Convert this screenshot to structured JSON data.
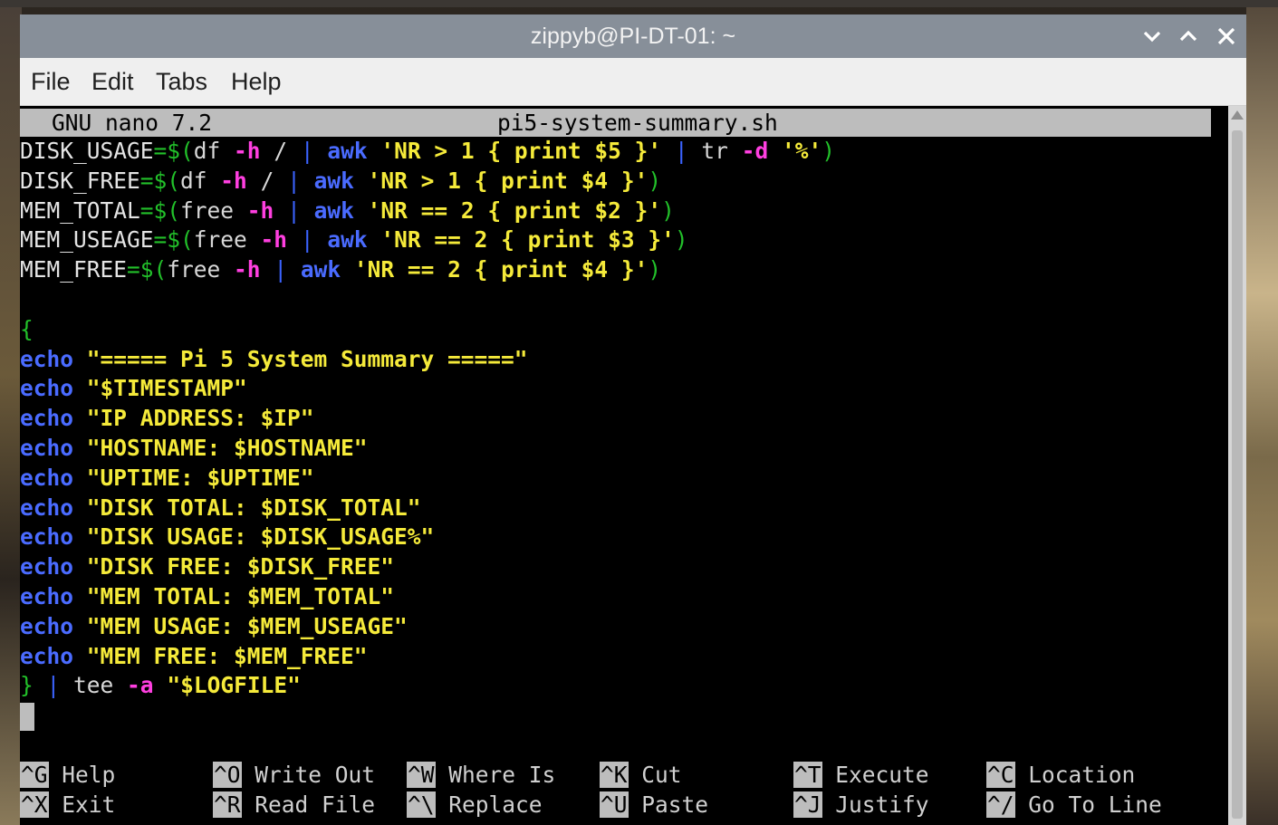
{
  "window": {
    "title": "zippyb@PI-DT-01: ~",
    "minimize_glyph": "⌵",
    "maximize_glyph": "⌃",
    "close_glyph": "✕"
  },
  "menu": {
    "file": "File",
    "edit": "Edit",
    "tabs": "Tabs",
    "help": "Help"
  },
  "nano": {
    "version": "GNU nano 7.2",
    "filename": "pi5-system-summary.sh"
  },
  "code_lines": [
    {
      "name": "disk-usage-line",
      "segments": [
        {
          "t": "DISK_USAGE",
          "c": "var"
        },
        {
          "t": "=$(",
          "c": "op"
        },
        {
          "t": "df ",
          "c": "cmd"
        },
        {
          "t": "-h",
          "c": "flag"
        },
        {
          "t": " / ",
          "c": "cmd"
        },
        {
          "t": "|",
          "c": "pipe"
        },
        {
          "t": " ",
          "c": "cmd"
        },
        {
          "t": "awk",
          "c": "kw"
        },
        {
          "t": " ",
          "c": "cmd"
        },
        {
          "t": "'NR > 1 { print $5 }'",
          "c": "str"
        },
        {
          "t": " | ",
          "c": "pipe"
        },
        {
          "t": "tr ",
          "c": "cmd"
        },
        {
          "t": "-d",
          "c": "flag"
        },
        {
          "t": " ",
          "c": "cmd"
        },
        {
          "t": "'%'",
          "c": "str"
        },
        {
          "t": ")",
          "c": "op"
        }
      ]
    },
    {
      "name": "disk-free-line",
      "segments": [
        {
          "t": "DISK_FREE",
          "c": "var"
        },
        {
          "t": "=$(",
          "c": "op"
        },
        {
          "t": "df ",
          "c": "cmd"
        },
        {
          "t": "-h",
          "c": "flag"
        },
        {
          "t": " / ",
          "c": "cmd"
        },
        {
          "t": "|",
          "c": "pipe"
        },
        {
          "t": " ",
          "c": "cmd"
        },
        {
          "t": "awk",
          "c": "kw"
        },
        {
          "t": " ",
          "c": "cmd"
        },
        {
          "t": "'NR > 1 { print $4 }'",
          "c": "str"
        },
        {
          "t": ")",
          "c": "op"
        }
      ]
    },
    {
      "name": "mem-total-line",
      "segments": [
        {
          "t": "MEM_TOTAL",
          "c": "var"
        },
        {
          "t": "=$(",
          "c": "op"
        },
        {
          "t": "free ",
          "c": "cmd"
        },
        {
          "t": "-h",
          "c": "flag"
        },
        {
          "t": " ",
          "c": "cmd"
        },
        {
          "t": "|",
          "c": "pipe"
        },
        {
          "t": " ",
          "c": "cmd"
        },
        {
          "t": "awk",
          "c": "kw"
        },
        {
          "t": " ",
          "c": "cmd"
        },
        {
          "t": "'NR == 2 { print $2 }'",
          "c": "str"
        },
        {
          "t": ")",
          "c": "op"
        }
      ]
    },
    {
      "name": "mem-useage-line",
      "segments": [
        {
          "t": "MEM_USEAGE",
          "c": "var"
        },
        {
          "t": "=$(",
          "c": "op"
        },
        {
          "t": "free ",
          "c": "cmd"
        },
        {
          "t": "-h",
          "c": "flag"
        },
        {
          "t": " ",
          "c": "cmd"
        },
        {
          "t": "|",
          "c": "pipe"
        },
        {
          "t": " ",
          "c": "cmd"
        },
        {
          "t": "awk",
          "c": "kw"
        },
        {
          "t": " ",
          "c": "cmd"
        },
        {
          "t": "'NR == 2 { print $3 }'",
          "c": "str"
        },
        {
          "t": ")",
          "c": "op"
        }
      ]
    },
    {
      "name": "mem-free-line",
      "segments": [
        {
          "t": "MEM_FREE",
          "c": "var"
        },
        {
          "t": "=$(",
          "c": "op"
        },
        {
          "t": "free ",
          "c": "cmd"
        },
        {
          "t": "-h",
          "c": "flag"
        },
        {
          "t": " ",
          "c": "cmd"
        },
        {
          "t": "|",
          "c": "pipe"
        },
        {
          "t": " ",
          "c": "cmd"
        },
        {
          "t": "awk",
          "c": "kw"
        },
        {
          "t": " ",
          "c": "cmd"
        },
        {
          "t": "'NR == 2 { print $4 }'",
          "c": "str"
        },
        {
          "t": ")",
          "c": "op"
        }
      ]
    },
    {
      "name": "blank-line",
      "segments": [
        {
          "t": " ",
          "c": "cmd"
        }
      ]
    },
    {
      "name": "open-brace-line",
      "segments": [
        {
          "t": "{",
          "c": "brace"
        }
      ]
    },
    {
      "name": "echo-title-line",
      "segments": [
        {
          "t": "echo",
          "c": "kw"
        },
        {
          "t": " ",
          "c": "cmd"
        },
        {
          "t": "\"===== Pi 5 System Summary =====\"",
          "c": "str"
        }
      ]
    },
    {
      "name": "echo-timestamp-line",
      "segments": [
        {
          "t": "echo",
          "c": "kw"
        },
        {
          "t": " ",
          "c": "cmd"
        },
        {
          "t": "\"$TIMESTAMP\"",
          "c": "str"
        }
      ]
    },
    {
      "name": "echo-ip-line",
      "segments": [
        {
          "t": "echo",
          "c": "kw"
        },
        {
          "t": " ",
          "c": "cmd"
        },
        {
          "t": "\"IP ADDRESS: $IP\"",
          "c": "str"
        }
      ]
    },
    {
      "name": "echo-hostname-line",
      "segments": [
        {
          "t": "echo",
          "c": "kw"
        },
        {
          "t": " ",
          "c": "cmd"
        },
        {
          "t": "\"HOSTNAME: $HOSTNAME\"",
          "c": "str"
        }
      ]
    },
    {
      "name": "echo-uptime-line",
      "segments": [
        {
          "t": "echo",
          "c": "kw"
        },
        {
          "t": " ",
          "c": "cmd"
        },
        {
          "t": "\"UPTIME: $UPTIME\"",
          "c": "str"
        }
      ]
    },
    {
      "name": "echo-disk-total-line",
      "segments": [
        {
          "t": "echo",
          "c": "kw"
        },
        {
          "t": " ",
          "c": "cmd"
        },
        {
          "t": "\"DISK TOTAL: $DISK_TOTAL\"",
          "c": "str"
        }
      ]
    },
    {
      "name": "echo-disk-usage-line",
      "segments": [
        {
          "t": "echo",
          "c": "kw"
        },
        {
          "t": " ",
          "c": "cmd"
        },
        {
          "t": "\"DISK USAGE: $DISK_USAGE%\"",
          "c": "str"
        }
      ]
    },
    {
      "name": "echo-disk-free-line",
      "segments": [
        {
          "t": "echo",
          "c": "kw"
        },
        {
          "t": " ",
          "c": "cmd"
        },
        {
          "t": "\"DISK FREE: $DISK_FREE\"",
          "c": "str"
        }
      ]
    },
    {
      "name": "echo-mem-total-line",
      "segments": [
        {
          "t": "echo",
          "c": "kw"
        },
        {
          "t": " ",
          "c": "cmd"
        },
        {
          "t": "\"MEM TOTAL: $MEM_TOTAL\"",
          "c": "str"
        }
      ]
    },
    {
      "name": "echo-mem-usage-line",
      "segments": [
        {
          "t": "echo",
          "c": "kw"
        },
        {
          "t": " ",
          "c": "cmd"
        },
        {
          "t": "\"MEM USAGE: $MEM_USEAGE\"",
          "c": "str"
        }
      ]
    },
    {
      "name": "echo-mem-free-line",
      "segments": [
        {
          "t": "echo",
          "c": "kw"
        },
        {
          "t": " ",
          "c": "cmd"
        },
        {
          "t": "\"MEM FREE: $MEM_FREE\"",
          "c": "str"
        }
      ]
    },
    {
      "name": "tee-line",
      "segments": [
        {
          "t": "}",
          "c": "brace"
        },
        {
          "t": " | ",
          "c": "pipe"
        },
        {
          "t": "tee ",
          "c": "cmd"
        },
        {
          "t": "-a",
          "c": "flag"
        },
        {
          "t": " ",
          "c": "cmd"
        },
        {
          "t": "\"$LOGFILE\"",
          "c": "str"
        }
      ]
    }
  ],
  "shortcuts": [
    {
      "key": "^G",
      "label": "Help"
    },
    {
      "key": "^O",
      "label": "Write Out"
    },
    {
      "key": "^W",
      "label": "Where Is"
    },
    {
      "key": "^K",
      "label": "Cut"
    },
    {
      "key": "^T",
      "label": "Execute"
    },
    {
      "key": "^C",
      "label": "Location"
    },
    {
      "key": "^X",
      "label": "Exit"
    },
    {
      "key": "^R",
      "label": "Read File"
    },
    {
      "key": "^\\",
      "label": "Replace"
    },
    {
      "key": "^U",
      "label": "Paste"
    },
    {
      "key": "^J",
      "label": "Justify"
    },
    {
      "key": "^/",
      "label": "Go To Line"
    }
  ]
}
